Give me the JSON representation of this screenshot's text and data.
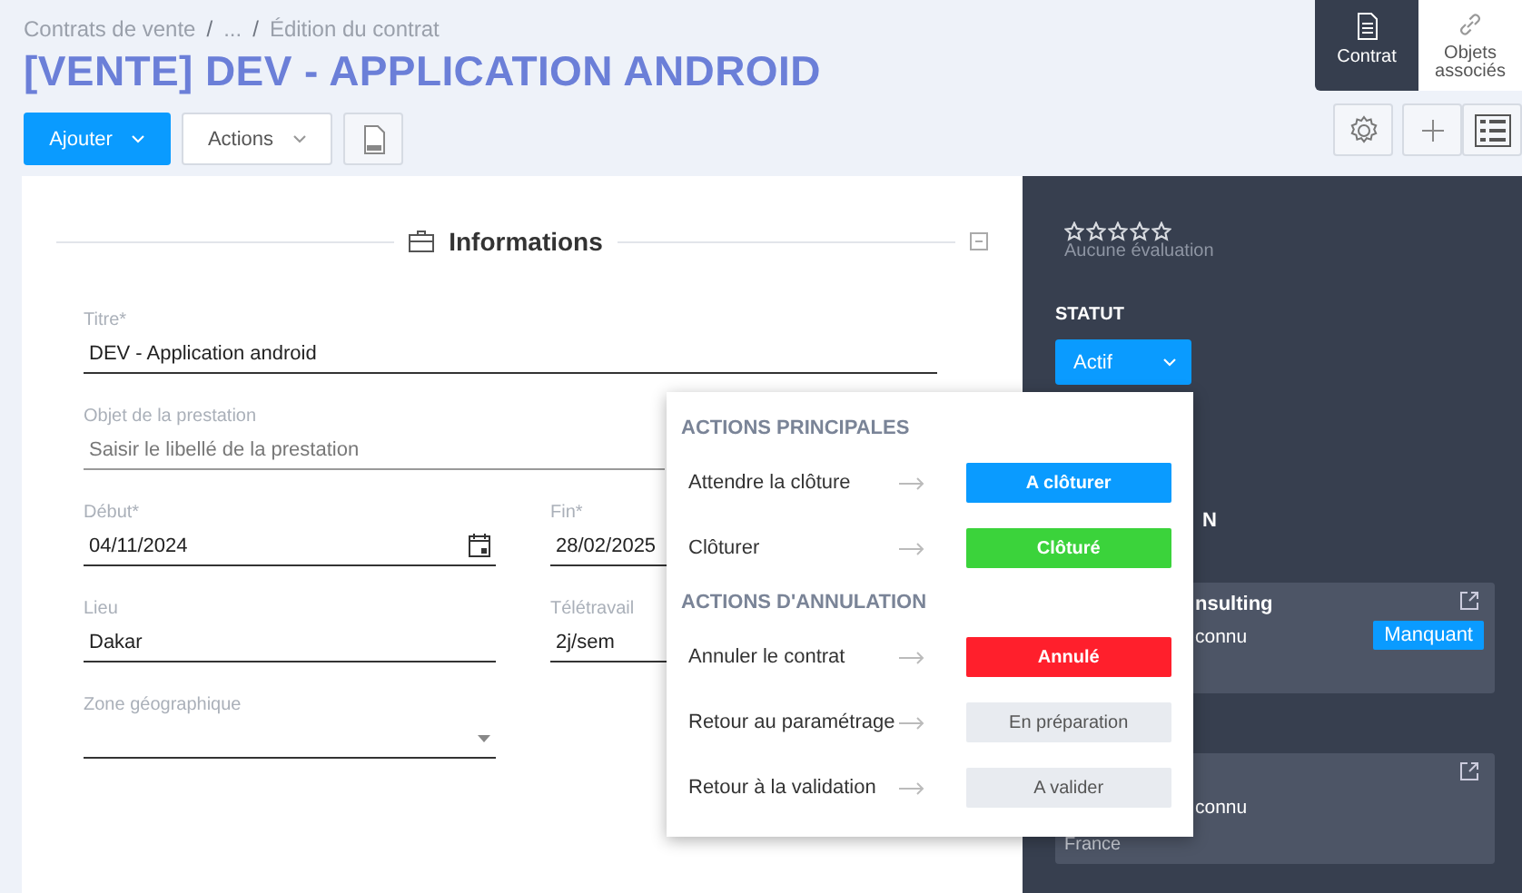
{
  "breadcrumb": [
    {
      "kind": "link",
      "text": "Contrats de vente"
    },
    {
      "kind": "separator",
      "text": "/"
    },
    {
      "kind": "link",
      "text": "..."
    },
    {
      "kind": "separator",
      "text": "/"
    },
    {
      "kind": "link",
      "text": "Édition du contrat"
    }
  ],
  "title": "[VENTE] DEV - APPLICATION ANDROID",
  "view_tabs": [
    {
      "label": "Contrat",
      "selected": true,
      "kind": "document"
    },
    {
      "label": "Objets associés",
      "selected": false,
      "kind": "link"
    }
  ],
  "toolbar": {
    "add_button": "Ajouter",
    "actions_button": "Actions"
  },
  "section": {
    "title": "Informations"
  },
  "form_rows": [
    [
      {
        "label": "Titre*",
        "value": "DEV - Application android",
        "kind": "text"
      }
    ],
    [
      {
        "label": "Objet de la prestation",
        "placeholder": "Saisir le libellé de la prestation",
        "kind": "text"
      }
    ],
    [
      {
        "label": "Début*",
        "value": "04/11/2024",
        "kind": "date"
      },
      {
        "label": "Fin*",
        "value": "28/02/2025",
        "kind": "text"
      }
    ],
    [
      {
        "label": "Lieu",
        "value": "Dakar",
        "kind": "text"
      },
      {
        "label": "Télétravail",
        "value": "2j/sem",
        "kind": "text"
      }
    ],
    [
      {
        "label": "Zone géographique",
        "kind": "select"
      }
    ]
  ],
  "rating": {
    "stars": 0,
    "caption": "Aucune évaluation"
  },
  "status": {
    "heading": "STATUT",
    "value": "Actif"
  },
  "side_heading": "N",
  "side_cards": [
    {
      "title": "nsulting",
      "lines": [
        "connu"
      ],
      "badge": "Manquant"
    },
    {
      "lines": [
        "connu",
        "France"
      ]
    }
  ],
  "status_menu": [
    {
      "title": "ACTIONS PRINCIPALES",
      "items": [
        {
          "label": "Attendre la clôture",
          "status": "A clôturer",
          "color": "#0a9bff"
        },
        {
          "label": "Clôturer",
          "status": "Clôturé",
          "color": "#3bd33b"
        }
      ]
    },
    {
      "title": "ACTIONS D'ANNULATION",
      "items": [
        {
          "label": "Annuler le contrat",
          "status": "Annulé",
          "color": "#ff1f2c"
        },
        {
          "label": "Retour au paramétrage",
          "status": "En préparation",
          "color": "#e8ebf0"
        },
        {
          "label": "Retour à la validation",
          "status": "A valider",
          "color": "#e8ebf0"
        }
      ]
    }
  ]
}
